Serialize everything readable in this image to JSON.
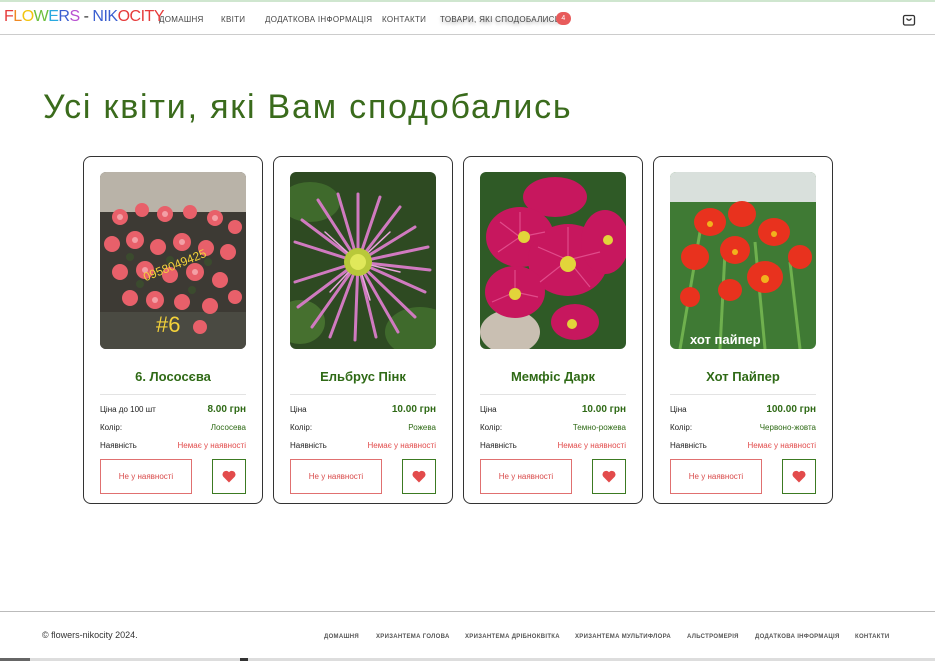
{
  "header": {
    "logo_letters": [
      {
        "ch": "F",
        "color": "#e63b3b"
      },
      {
        "ch": "L",
        "color": "#f08a24"
      },
      {
        "ch": "O",
        "color": "#f2c40f"
      },
      {
        "ch": "W",
        "color": "#6cbf3c"
      },
      {
        "ch": "E",
        "color": "#29a9e0"
      },
      {
        "ch": "R",
        "color": "#3b5fd0"
      },
      {
        "ch": "S",
        "color": "#b84fd0"
      },
      {
        "ch": " - ",
        "color": "#333333"
      },
      {
        "ch": "N",
        "color": "#3b5fd0"
      },
      {
        "ch": "I",
        "color": "#3b5fd0"
      },
      {
        "ch": "K",
        "color": "#3b5fd0"
      },
      {
        "ch": "O",
        "color": "#e63b3b"
      },
      {
        "ch": "C",
        "color": "#e63b3b"
      },
      {
        "ch": "I",
        "color": "#e63b3b"
      },
      {
        "ch": "T",
        "color": "#e63b3b"
      },
      {
        "ch": "Y",
        "color": "#e63b3b"
      }
    ],
    "nav": {
      "home": "Домашня",
      "flowers": "Квіти",
      "info": "Додаткова інформація",
      "contacts": "Контакти",
      "liked": "Товари, які сподобались"
    },
    "liked_count": "4",
    "cart_icon": "shopping-bag-icon"
  },
  "page": {
    "title": "Усі квіти, які Вам сподобались"
  },
  "products": [
    {
      "name": "6. Лососєва",
      "price_label": "Ціна до 100 шт",
      "price": "8.00 грн",
      "color_label": "Колір:",
      "color": "Лососева",
      "availability_label": "Наявність",
      "availability": "Немає у наявності",
      "button": "Не у наявності",
      "photo_caption": "#6",
      "photo_phone": "0958049425"
    },
    {
      "name": "Ельбрус Пінк",
      "price_label": "Ціна",
      "price": "10.00 грн",
      "color_label": "Колір:",
      "color": "Рожева",
      "availability_label": "Наявність",
      "availability": "Немає у наявності",
      "button": "Не у наявності"
    },
    {
      "name": "Мемфіс Дарк",
      "price_label": "Ціна",
      "price": "10.00 грн",
      "color_label": "Колір:",
      "color": "Темно-рожева",
      "availability_label": "Наявність",
      "availability": "Немає у наявності",
      "button": "Не у наявності"
    },
    {
      "name": "Хот Пайпер",
      "price_label": "Ціна",
      "price": "100.00 грн",
      "color_label": "Колір:",
      "color": "Червоно-жовта",
      "availability_label": "Наявність",
      "availability": "Немає у наявності",
      "button": "Не у наявності",
      "photo_caption": "хот пайпер"
    }
  ],
  "footer": {
    "copyright": "© flowers-nikocity 2024.",
    "links": [
      "Домашня",
      "Хризантема голова",
      "Хризантема дрібноквітка",
      "Хризантема мультифлора",
      "Альстромерія",
      "Додаткова інформація",
      "Контакти"
    ]
  },
  "colors": {
    "accent_green": "#2f6a16",
    "unavailable_red": "#e24b4b",
    "badge": "#e85b5b"
  }
}
